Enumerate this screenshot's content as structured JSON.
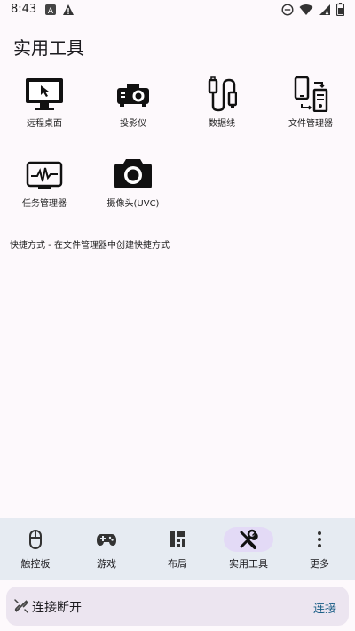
{
  "status_bar": {
    "time": "8:43"
  },
  "page": {
    "title": "实用工具"
  },
  "tools": [
    {
      "label": "远程桌面",
      "icon": "monitor-icon"
    },
    {
      "label": "投影仪",
      "icon": "projector-icon"
    },
    {
      "label": "数据线",
      "icon": "usb-cable-icon"
    },
    {
      "label": "文件管理器",
      "icon": "file-manager-icon"
    },
    {
      "label": "任务管理器",
      "icon": "task-manager-icon"
    },
    {
      "label": "摄像头(UVC)",
      "icon": "camera-icon"
    }
  ],
  "hint": "快捷方式 - 在文件管理器中创建快捷方式",
  "bottom_nav": [
    {
      "label": "触控板",
      "icon": "mouse-icon",
      "active": false
    },
    {
      "label": "游戏",
      "icon": "gamepad-icon",
      "active": false
    },
    {
      "label": "布局",
      "icon": "layout-icon",
      "active": false
    },
    {
      "label": "实用工具",
      "icon": "tools-icon",
      "active": true
    },
    {
      "label": "更多",
      "icon": "more-icon",
      "active": false
    }
  ],
  "connection": {
    "status": "连接断开",
    "action": "连接"
  },
  "colors": {
    "accent": "#1a5e86",
    "nav_bg": "#e6ebf2",
    "active_pill": "#e3daf6"
  }
}
